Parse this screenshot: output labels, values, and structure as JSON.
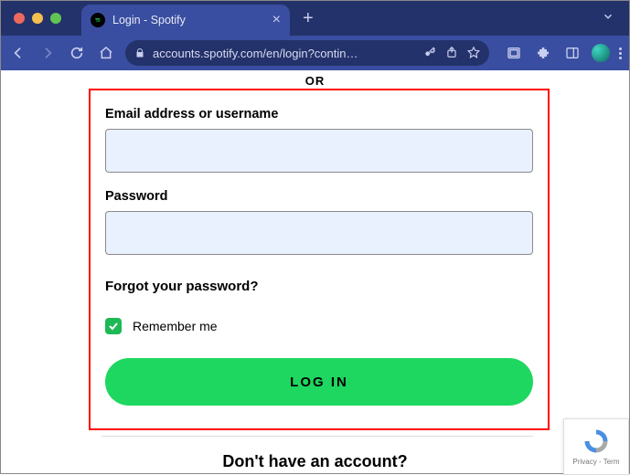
{
  "browser": {
    "tab_title": "Login - Spotify",
    "url": "accounts.spotify.com/en/login?contin…"
  },
  "form": {
    "divider": "OR",
    "email_label": "Email address or username",
    "email_value": "",
    "password_label": "Password",
    "password_value": "",
    "forgot": "Forgot your password?",
    "remember_label": "Remember me",
    "remember_checked": true,
    "login_button": "LOG IN"
  },
  "footer": {
    "no_account": "Don't have an account?"
  },
  "recaptcha": {
    "line": "Privacy - Term"
  }
}
